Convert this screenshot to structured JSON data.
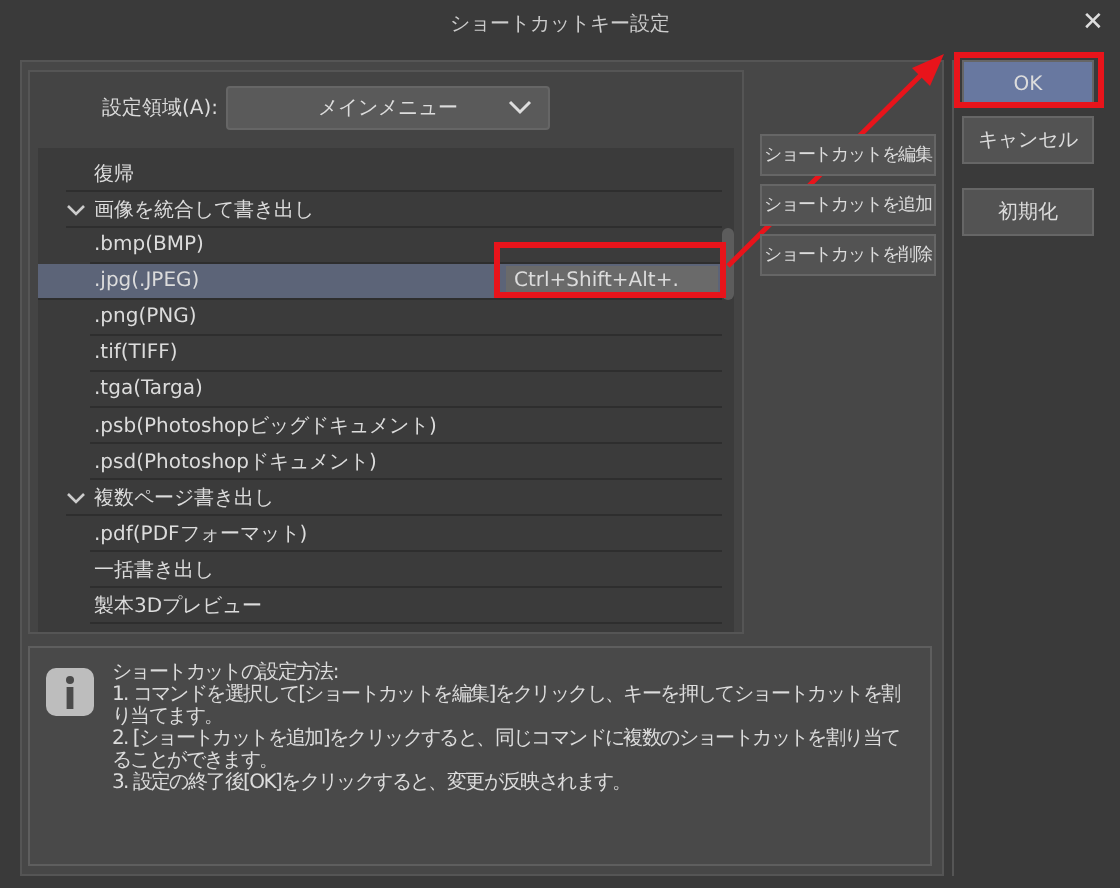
{
  "window": {
    "title": "ショートカットキー設定",
    "close": "✕"
  },
  "area": {
    "label": "設定領域(A):",
    "value": "メインメニュー"
  },
  "commands": [
    {
      "label": "復帰",
      "selected": false
    },
    {
      "label": "画像を統合して書き出し",
      "selected": false,
      "expanded": true,
      "children": [
        {
          "label": ".bmp(BMP)",
          "selected": false
        },
        {
          "label": ".jpg(.JPEG)",
          "selected": true,
          "shortcut": "Ctrl+Shift+Alt+."
        },
        {
          "label": ".png(PNG)",
          "selected": false
        },
        {
          "label": ".tif(TIFF)",
          "selected": false
        },
        {
          "label": ".tga(Targa)",
          "selected": false
        },
        {
          "label": ".psb(Photoshopビッグドキュメント)",
          "selected": false
        },
        {
          "label": ".psd(Photoshopドキュメント)",
          "selected": false
        }
      ]
    },
    {
      "label": "複数ページ書き出し",
      "selected": false,
      "expanded": true,
      "children": [
        {
          "label": ".pdf(PDFフォーマット)",
          "selected": false
        },
        {
          "label": "一括書き出し",
          "selected": false
        },
        {
          "label": "製本3Dプレビュー",
          "selected": false
        }
      ]
    }
  ],
  "shortcut_buttons": [
    "ショートカットを編集",
    "ショートカットを追加",
    "ショートカットを削除"
  ],
  "dialog_buttons": [
    {
      "label": "OK",
      "primary": true
    },
    {
      "label": "キャンセル",
      "primary": false
    },
    {
      "label": "初期化",
      "primary": false
    }
  ],
  "info": {
    "title": "ショートカットの設定方法:",
    "lines": [
      "1. コマンドを選択して[ショートカットを編集]をクリックし、キーを押してショートカットを割り当てます。",
      "2. [ショートカットを追加]をクリックすると、同じコマンドに複数のショートカットを割り当てることができます。",
      "3. 設定の終了後[OK]をクリックすると、変更が反映されます。"
    ]
  }
}
